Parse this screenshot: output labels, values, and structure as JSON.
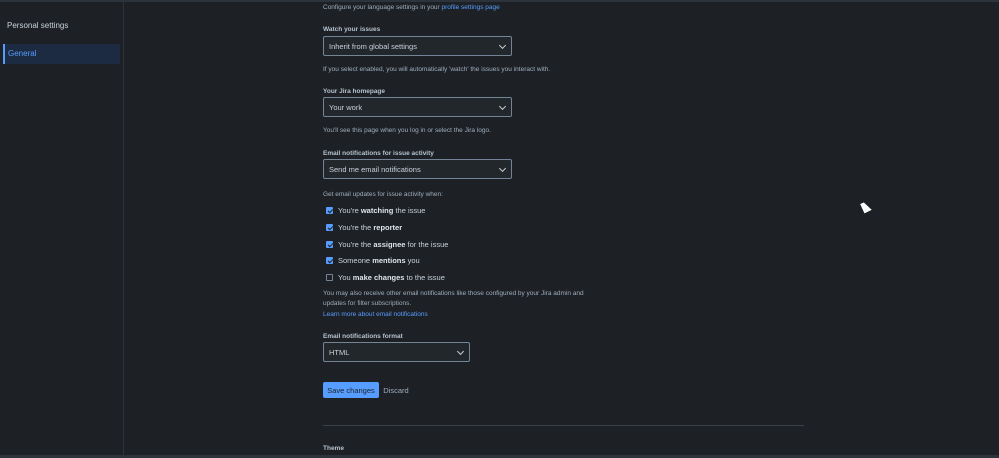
{
  "sidebar": {
    "title": "Personal settings",
    "items": [
      {
        "label": "General"
      }
    ]
  },
  "language": {
    "text": "Configure your language settings in your ",
    "link": "profile settings page"
  },
  "watch": {
    "label": "Watch your issues",
    "value": "Inherit from global settings",
    "help": "If you select enabled, you will automatically 'watch' the issues you interact with."
  },
  "homepage": {
    "label": "Your Jira homepage",
    "value": "Your work",
    "help": "You'll see this page when you log in or select the Jira logo."
  },
  "email_activity": {
    "label": "Email notifications for issue activity",
    "value": "Send me email notifications",
    "intro": "Get email updates for issue activity when:",
    "options": [
      {
        "pre": "You're ",
        "bold": "watching",
        "post": " the issue",
        "checked": true
      },
      {
        "pre": "You're the ",
        "bold": "reporter",
        "post": "",
        "checked": true
      },
      {
        "pre": "You're the ",
        "bold": "assignee",
        "post": " for the issue",
        "checked": true
      },
      {
        "pre": "Someone ",
        "bold": "mentions",
        "post": " you",
        "checked": true
      },
      {
        "pre": "You ",
        "bold": "make changes",
        "post": " to the issue",
        "checked": false
      }
    ],
    "note_line1": "You may also receive other email notifications like those configured by your Jira admin and",
    "note_line2": "updates for filter subscriptions.",
    "learn_more": "Learn more about email notifications"
  },
  "email_format": {
    "label": "Email notifications format",
    "value": "HTML"
  },
  "actions": {
    "save": "Save changes",
    "discard": "Discard"
  },
  "theme": {
    "label": "Theme"
  }
}
